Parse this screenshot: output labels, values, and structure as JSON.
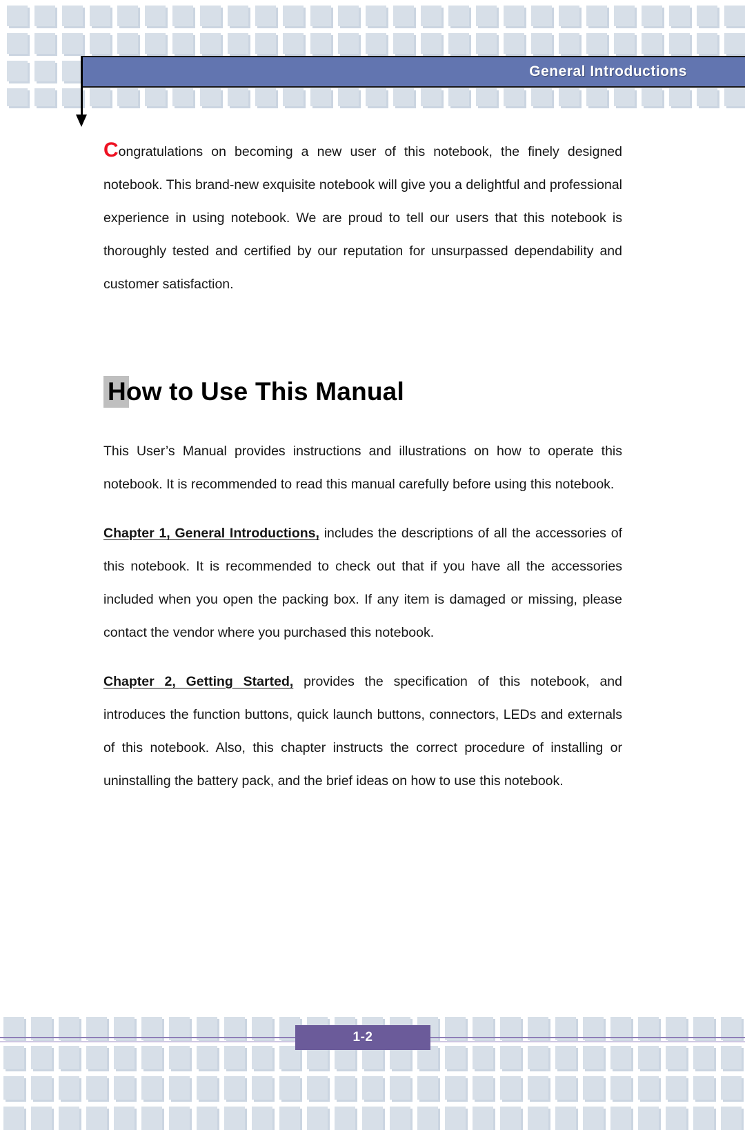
{
  "document": {
    "header": {
      "title": "General  Introductions"
    },
    "intro_paragraph": {
      "dropcap": "C",
      "rest": "ongratulations on becoming a new user of this notebook, the finely designed notebook.   This brand-new exquisite notebook will give you a delightful and professional experience in using notebook.   We are proud to tell our users that this notebook is thoroughly tested and certified by our reputation for unsurpassed dependability and customer satisfaction."
    },
    "section": {
      "heading": "How to Use This Manual",
      "paragraph_1": "This User’s Manual provides instructions and illustrations on how to operate this notebook.   It is recommended to read this manual carefully before using this notebook.",
      "chapter_1": {
        "label": "Chapter 1, General Introductions,",
        "text": " includes the descriptions of all the accessories of this notebook.   It is recommended to check out that if you have all the accessories included when you open the packing box.   If any item is damaged or missing, please contact the vendor where you purchased this notebook."
      },
      "chapter_2": {
        "label": "Chapter 2, Getting Started,",
        "text": " provides the specification of this notebook, and introduces the function buttons, quick launch buttons, connectors, LEDs and externals of this notebook.   Also, this chapter instructs the correct procedure of installing or uninstalling the battery pack, and the brief ideas on how to use this notebook."
      }
    },
    "footer": {
      "page_number": "1-2"
    },
    "colors": {
      "header_bar": "#6275b0",
      "page_badge": "#6b5b9a",
      "dropcap": "#ee1122",
      "deco_square": "#d7dfe8",
      "heading_block": "#bfbfbf",
      "footer_rule": "#8f7fb8"
    }
  }
}
